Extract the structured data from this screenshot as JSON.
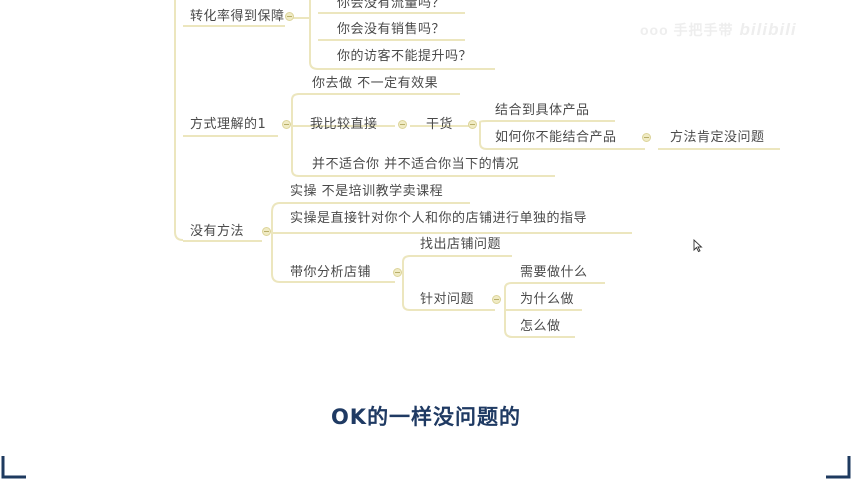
{
  "mindmap": {
    "branches": [
      {
        "label": "转化率得到保障",
        "children": [
          "你会没有流量吗？",
          "你会没有销售吗？",
          "你的访客不能提升吗？"
        ]
      },
      {
        "label": "方式理解的1",
        "children": [
          "你去做  不一定有效果",
          "我比较直接",
          "并不适合你   并不适合你当下的情况"
        ],
        "sub": {
          "node": "干货",
          "children": [
            "结合到具体产品",
            "如何你不能结合产品"
          ],
          "leaf": "方法肯定没问题"
        }
      },
      {
        "label": "没有方法",
        "children": [
          "实操   不是培训教学卖课程",
          "实操是直接针对你个人和你的店铺进行单独的指导",
          "带你分析店铺"
        ],
        "sub": {
          "children": [
            "找出店铺问题",
            "针对问题"
          ],
          "leaves": [
            "需要做什么",
            "为什么做",
            "怎么做"
          ]
        }
      }
    ]
  },
  "watermark": {
    "text": "ooo 手把手带",
    "logo": "bilibili"
  },
  "subtitle": "OK的一样没问题的",
  "colors": {
    "line": "#ece6be",
    "text": "#4a4a4a",
    "subtitle": "#1f3a63",
    "corner": "#1e3a5f"
  },
  "icons": {
    "toggle": "collapse-toggle-icon",
    "cursor": "mouse-pointer-icon"
  }
}
